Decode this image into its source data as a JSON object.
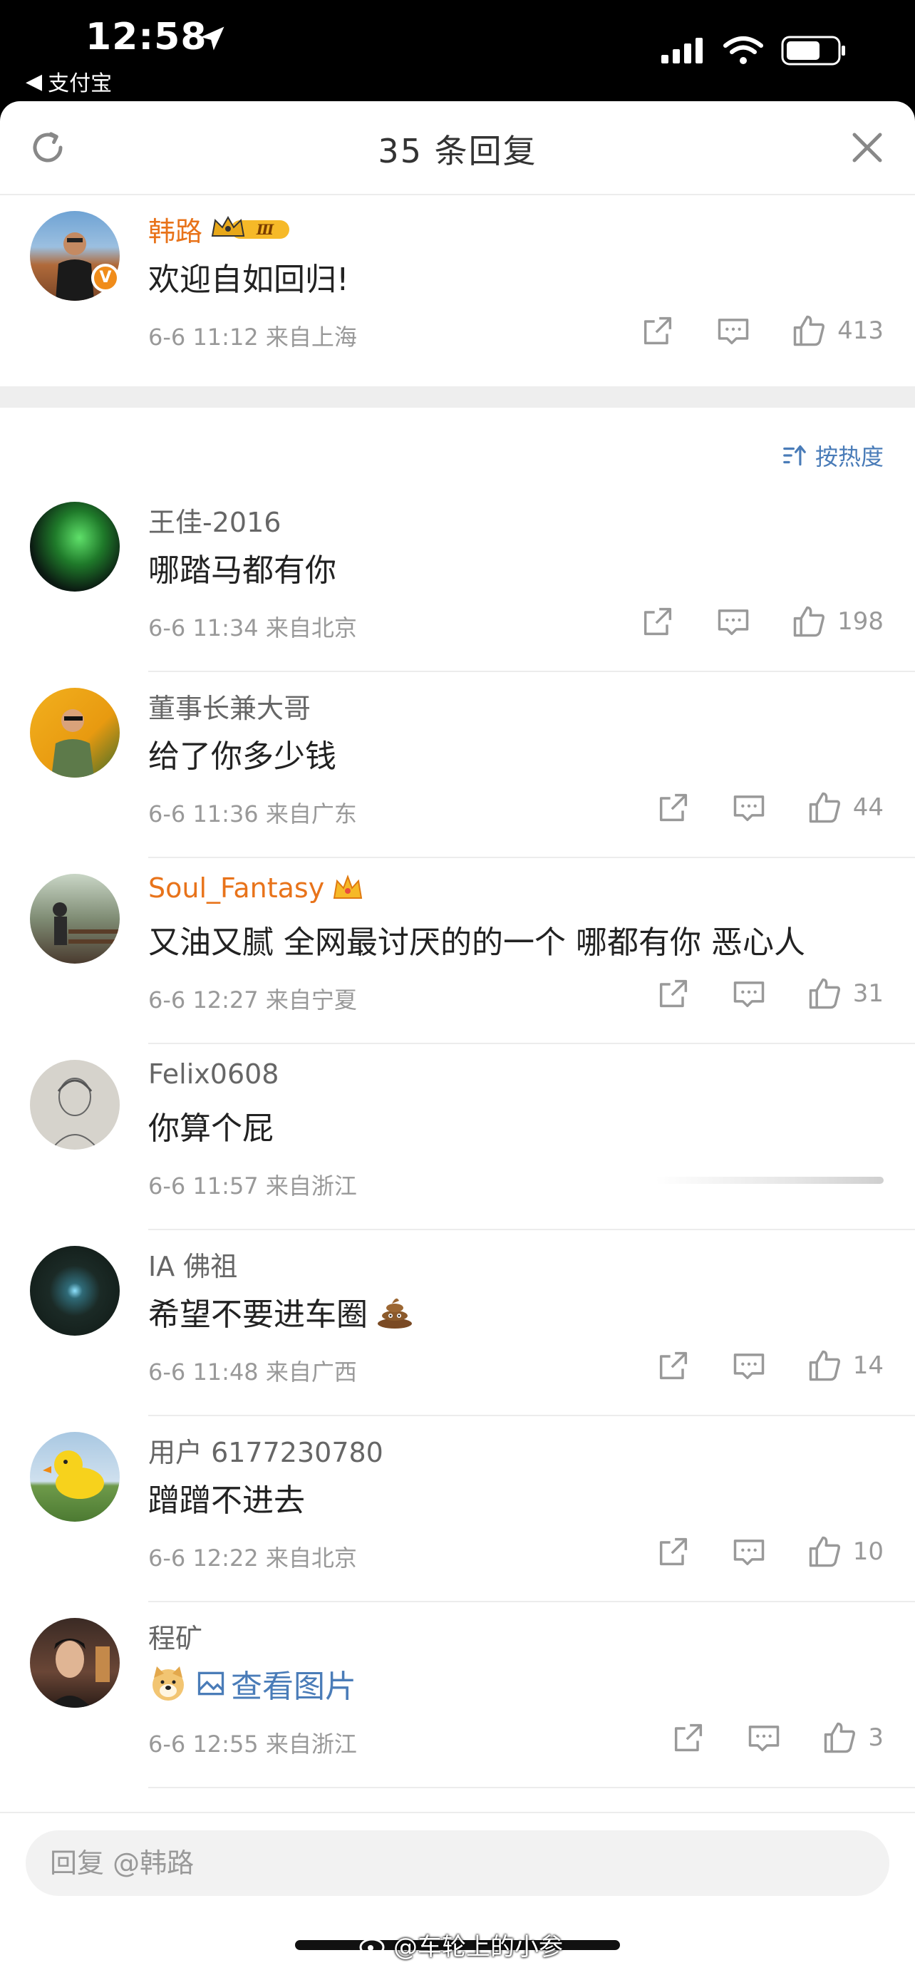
{
  "status_bar": {
    "time": "12:58",
    "back_app": "支付宝"
  },
  "header": {
    "title": "35 条回复"
  },
  "main_comment": {
    "user": "韩路",
    "text": "欢迎自如回归!",
    "meta": "6-6 11:12  来自上海",
    "likes": "413",
    "badge_level": "Ⅲ"
  },
  "sort": {
    "label": "按热度"
  },
  "replies": [
    {
      "user": "王佳-2016",
      "text": "哪踏马都有你",
      "meta": "6-6 11:34  来自北京",
      "likes": "198"
    },
    {
      "user": "董事长兼大哥",
      "text": "给了你多少钱",
      "meta": "6-6 11:36  来自广东",
      "likes": "44"
    },
    {
      "user": "Soul_Fantasy",
      "text": "又油又腻 全网最讨厌的的一个 哪都有你 恶心人",
      "meta": "6-6 12:27  来自宁夏",
      "likes": "31"
    },
    {
      "user": "Felix0608",
      "text": "你算个屁",
      "meta": "6-6 11:57  来自浙江",
      "likes": ""
    },
    {
      "user": "IA 佛祖",
      "text": "希望不要进车圈",
      "meta": "6-6 11:48  来自广西",
      "likes": "14"
    },
    {
      "user": "用户 6177230780",
      "text": "蹭蹭不进去",
      "meta": "6-6 12:22  来自北京",
      "likes": "10"
    },
    {
      "user": "程矿",
      "text": "查看图片",
      "meta": "6-6 12:55  来自浙江",
      "likes": "3"
    }
  ],
  "reply_input": {
    "placeholder": "回复 @韩路"
  },
  "watermark": "@车轮上的小参",
  "colors": {
    "accent_blue": "#4a7cb8",
    "vip_orange": "#e8731a",
    "meta_gray": "#999999"
  }
}
